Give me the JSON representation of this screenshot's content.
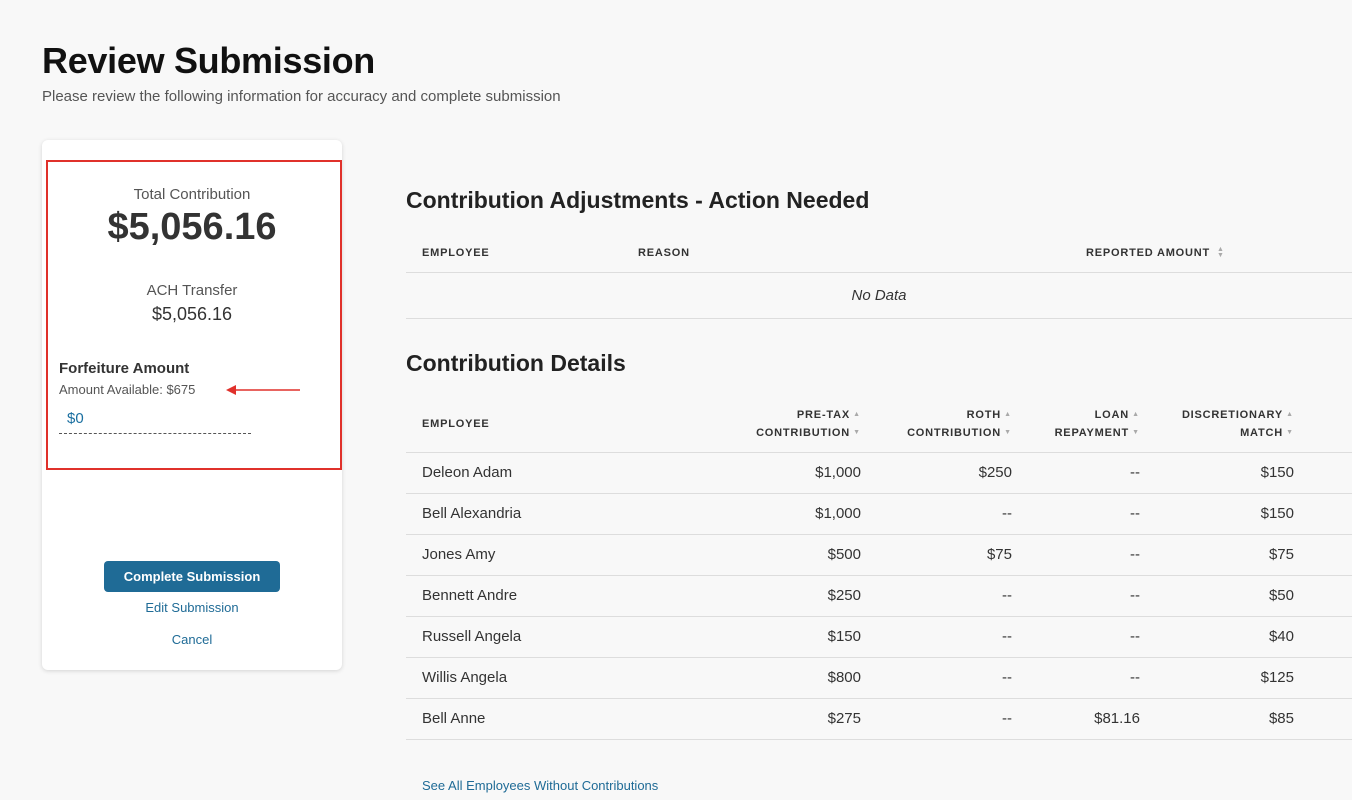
{
  "header": {
    "title": "Review Submission",
    "subtitle": "Please review the following information for accuracy and complete submission"
  },
  "summary": {
    "total_label": "Total Contribution",
    "total_value": "$5,056.16",
    "ach_label": "ACH Transfer",
    "ach_value": "$5,056.16",
    "forfeiture_title": "Forfeiture Amount",
    "forfeiture_available": "Amount Available: $675",
    "forfeiture_value": "$0",
    "complete_label": "Complete Submission",
    "edit_label": "Edit Submission",
    "cancel_label": "Cancel",
    "highlight_color": "#e0312b"
  },
  "adjustments": {
    "title": "Contribution Adjustments - Action Needed",
    "columns": [
      "Employee",
      "Reason",
      "Reported Amount"
    ],
    "empty_text": "No Data"
  },
  "details": {
    "title": "Contribution Details",
    "columns": {
      "employee": "Employee",
      "pretax_1": "Pre-Tax",
      "pretax_2": "Contribution",
      "roth_1": "Roth",
      "roth_2": "Contribution",
      "loan_1": "Loan",
      "loan_2": "Repayment",
      "disc_1": "Discretionary",
      "disc_2": "Match"
    },
    "rows": [
      {
        "employee": "Deleon Adam",
        "pretax": "$1,000",
        "roth": "$250",
        "loan": "--",
        "match": "$150"
      },
      {
        "employee": "Bell Alexandria",
        "pretax": "$1,000",
        "roth": "--",
        "loan": "--",
        "match": "$150"
      },
      {
        "employee": "Jones Amy",
        "pretax": "$500",
        "roth": "$75",
        "loan": "--",
        "match": "$75"
      },
      {
        "employee": "Bennett Andre",
        "pretax": "$250",
        "roth": "--",
        "loan": "--",
        "match": "$50"
      },
      {
        "employee": "Russell Angela",
        "pretax": "$150",
        "roth": "--",
        "loan": "--",
        "match": "$40"
      },
      {
        "employee": "Willis Angela",
        "pretax": "$800",
        "roth": "--",
        "loan": "--",
        "match": "$125"
      },
      {
        "employee": "Bell Anne",
        "pretax": "$275",
        "roth": "--",
        "loan": "$81.16",
        "match": "$85"
      }
    ],
    "see_all_label": "See All Employees Without Contributions"
  },
  "colors": {
    "accent": "#1f6b96",
    "background": "#f8f8f8"
  }
}
